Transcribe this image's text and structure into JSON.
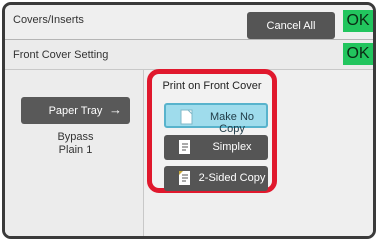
{
  "header": {
    "title": "Covers/Inserts",
    "cancel_all_label": "Cancel All",
    "ok_label": "OK"
  },
  "section": {
    "title": "Front Cover Setting",
    "ok_label": "OK"
  },
  "paper_tray": {
    "label": "Paper Tray",
    "arrow_glyph": "→",
    "source": "Bypass",
    "type": "Plain 1"
  },
  "print_on_front_cover": {
    "label": "Print on Front Cover",
    "options": [
      {
        "label": "Make No Copy",
        "selected": true
      },
      {
        "label": "Simplex",
        "selected": false
      },
      {
        "label": "2-Sided Copy",
        "selected": false
      }
    ]
  },
  "colors": {
    "ok_green": "#22c55e",
    "highlight_red": "#e0182d",
    "selected_blue": "#9fdcec",
    "button_gray": "#555555"
  }
}
